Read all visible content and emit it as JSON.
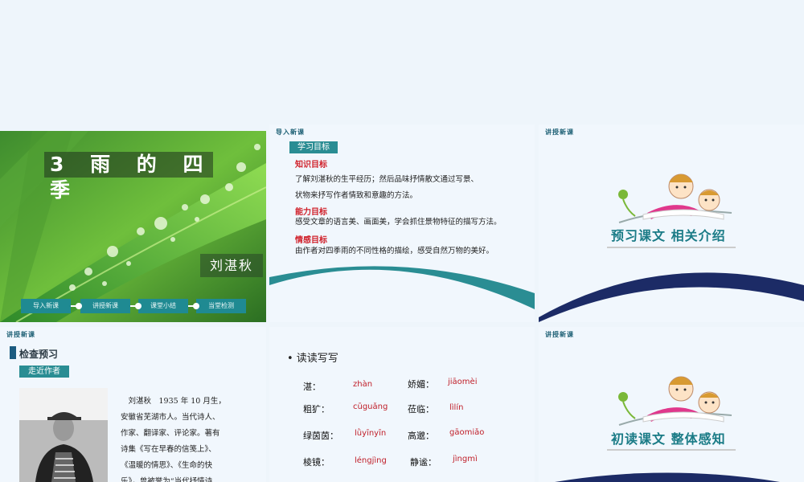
{
  "slide1": {
    "title": "3 雨 的 四 季",
    "author": "刘湛秋",
    "nav": [
      "导入新课",
      "讲授新课",
      "课堂小结",
      "当堂检测"
    ]
  },
  "slide2": {
    "header": "导入新课",
    "pill": "学习目标",
    "sections": [
      {
        "heading": "知识目标",
        "lines": [
          "了解刘湛秋的生平经历；然后品味抒情散文通过写景、",
          "状物来抒写作者情致和意趣的方法。"
        ]
      },
      {
        "heading": "能力目标",
        "lines": [
          "感受文章的语言美、画面美，学会抓住景物特征的描写方法。"
        ]
      },
      {
        "heading": "情感目标",
        "lines": [
          "由作者对四季雨的不同性格的描绘，感受自然万物的美好。"
        ]
      }
    ]
  },
  "slide3": {
    "header": "讲授新课",
    "title": "预习课文    相关介绍"
  },
  "slide4": {
    "header": "讲授新课",
    "section_title": "检查预习",
    "pill": "走近作者",
    "bio_lines": [
      "　刘湛秋　1935 年 10 月生，",
      "安徽省芜湖市人。当代诗人、",
      "作家、翻译家、评论家。著有",
      "诗集《写在早春的信笺上》、",
      "《温暖的情思》、《生命的快",
      "乐》，曾被誉为“当代抒情诗"
    ]
  },
  "slide5": {
    "bullet": "• 读读写写",
    "words": [
      {
        "word": "湛：",
        "pinyin": "zhàn"
      },
      {
        "word": "娇媚：",
        "pinyin": "jiāomèi"
      },
      {
        "word": "粗犷：",
        "pinyin": "cūguǎng"
      },
      {
        "word": "莅临：",
        "pinyin": "lìlín"
      },
      {
        "word": "绿茵茵：",
        "pinyin": "lǜyīnyīn"
      },
      {
        "word": "高邈：",
        "pinyin": "gāomiǎo"
      },
      {
        "word": "棱镜：",
        "pinyin": "léngjìng"
      },
      {
        "word": "静谧：",
        "pinyin": "jìngmì"
      }
    ]
  },
  "slide6": {
    "header": "讲授新课",
    "title": "初读课文    整体感知"
  },
  "colors": {
    "teal": "#1f8a92",
    "red": "#d0202a",
    "navy": "#1c2b66",
    "title_teal": "#1a7b86"
  }
}
